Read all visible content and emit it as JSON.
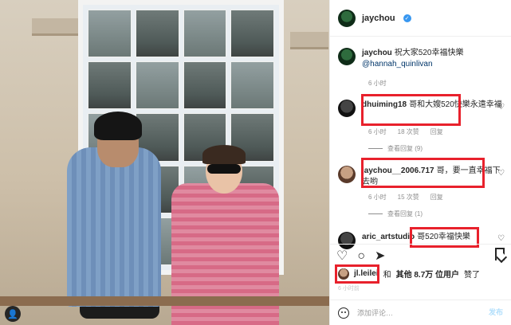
{
  "header": {
    "username": "jaychou",
    "verified_symbol": "✓"
  },
  "caption": {
    "username": "jaychou",
    "text": "祝大家520幸福快樂",
    "mention": "@hannah_quinlivan",
    "time": "6 小时"
  },
  "comments": [
    {
      "username": "dhuiming18",
      "text": "哥和大嫂520快樂永遠幸福",
      "time": "6 小时",
      "likes": "18 次赞",
      "reply": "回复",
      "view_replies": "查看回复 (9)"
    },
    {
      "username": "jaychou__2006.717",
      "text": "哥，要一直幸福下去哟",
      "time": "6 小时",
      "likes": "15 次赞",
      "reply": "回复",
      "view_replies": "查看回复 (1)"
    },
    {
      "username": "aric_artstudio",
      "text": "哥520幸福快樂"
    }
  ],
  "likes": {
    "username": "jl.leilei",
    "text_1": "和",
    "others": "其他",
    "count": "8.7万",
    "text_2": "位用户",
    "text_3": "赞了"
  },
  "post_time": "6 小时前",
  "comment_bar": {
    "placeholder": "添加评论…",
    "publish": "发布"
  },
  "icons": {
    "heart": "♡",
    "comment": "○",
    "share": "➤",
    "badge": "👤"
  },
  "colors": {
    "highlight": "#e8212c",
    "verified": "#3897f0",
    "link": "#003569"
  }
}
